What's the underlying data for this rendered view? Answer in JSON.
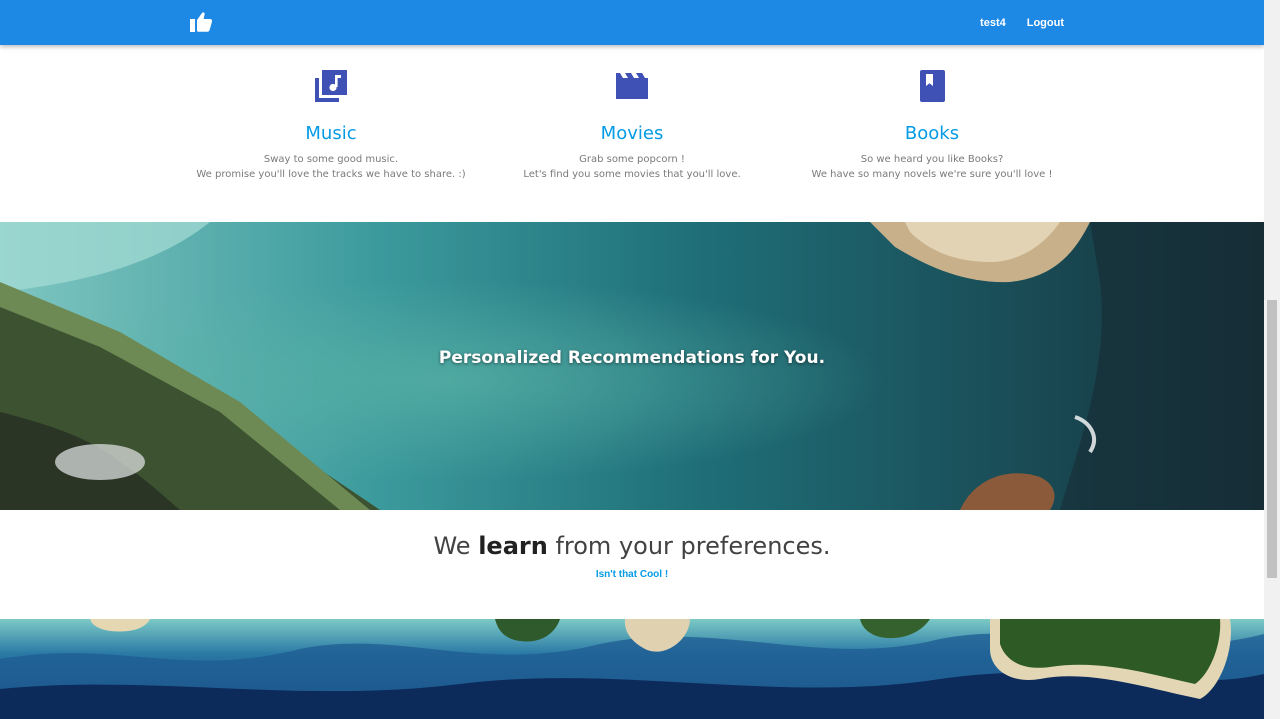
{
  "navbar": {
    "logo_icon": "thumbs-up-icon",
    "user_label": "test4",
    "logout_label": "Logout",
    "color": "#1e88e5"
  },
  "features": [
    {
      "icon": "music-library-icon",
      "title": "Music",
      "line1": "Sway to some good music.",
      "line2": "We promise you'll love the tracks we have to share. :)"
    },
    {
      "icon": "movie-clapper-icon",
      "title": "Movies",
      "line1": "Grab some popcorn !",
      "line2": "Let's find you some movies that you'll love."
    },
    {
      "icon": "book-icon",
      "title": "Books",
      "line1": "So we heard you like Books?",
      "line2": "We have so many novels we're sure you'll love !"
    }
  ],
  "banner": {
    "title": "Personalized Recommendations for You."
  },
  "tagline": {
    "prefix": "We ",
    "bold": "learn",
    "suffix": " from your preferences.",
    "link_label": "Isn't that Cool !"
  },
  "colors": {
    "accent": "#039be5",
    "icon": "#3f51b5"
  }
}
